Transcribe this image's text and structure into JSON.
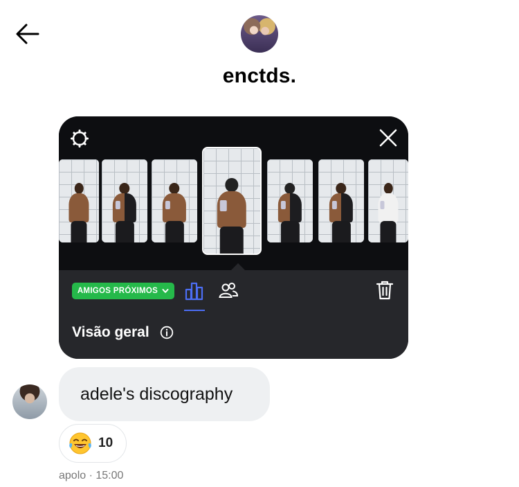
{
  "header": {
    "back_icon": "arrow-left-icon",
    "username": "enctds."
  },
  "story": {
    "settings_icon": "gear-icon",
    "close_icon": "close-icon",
    "audience_label": "AMIGOS PRÓXIMOS",
    "overview_label": "Visão geral",
    "tabs": [
      "stats-icon",
      "viewers-icon"
    ],
    "delete_icon": "trash-icon",
    "info_icon": "info-icon",
    "accent_color": "#25b94a",
    "tab_active_color": "#4c6ef5"
  },
  "message": {
    "text": "adele's discography",
    "reaction_emoji": "laughing-tears-emoji",
    "reaction_count": "10",
    "timestamp": "apolo · 15:00"
  }
}
